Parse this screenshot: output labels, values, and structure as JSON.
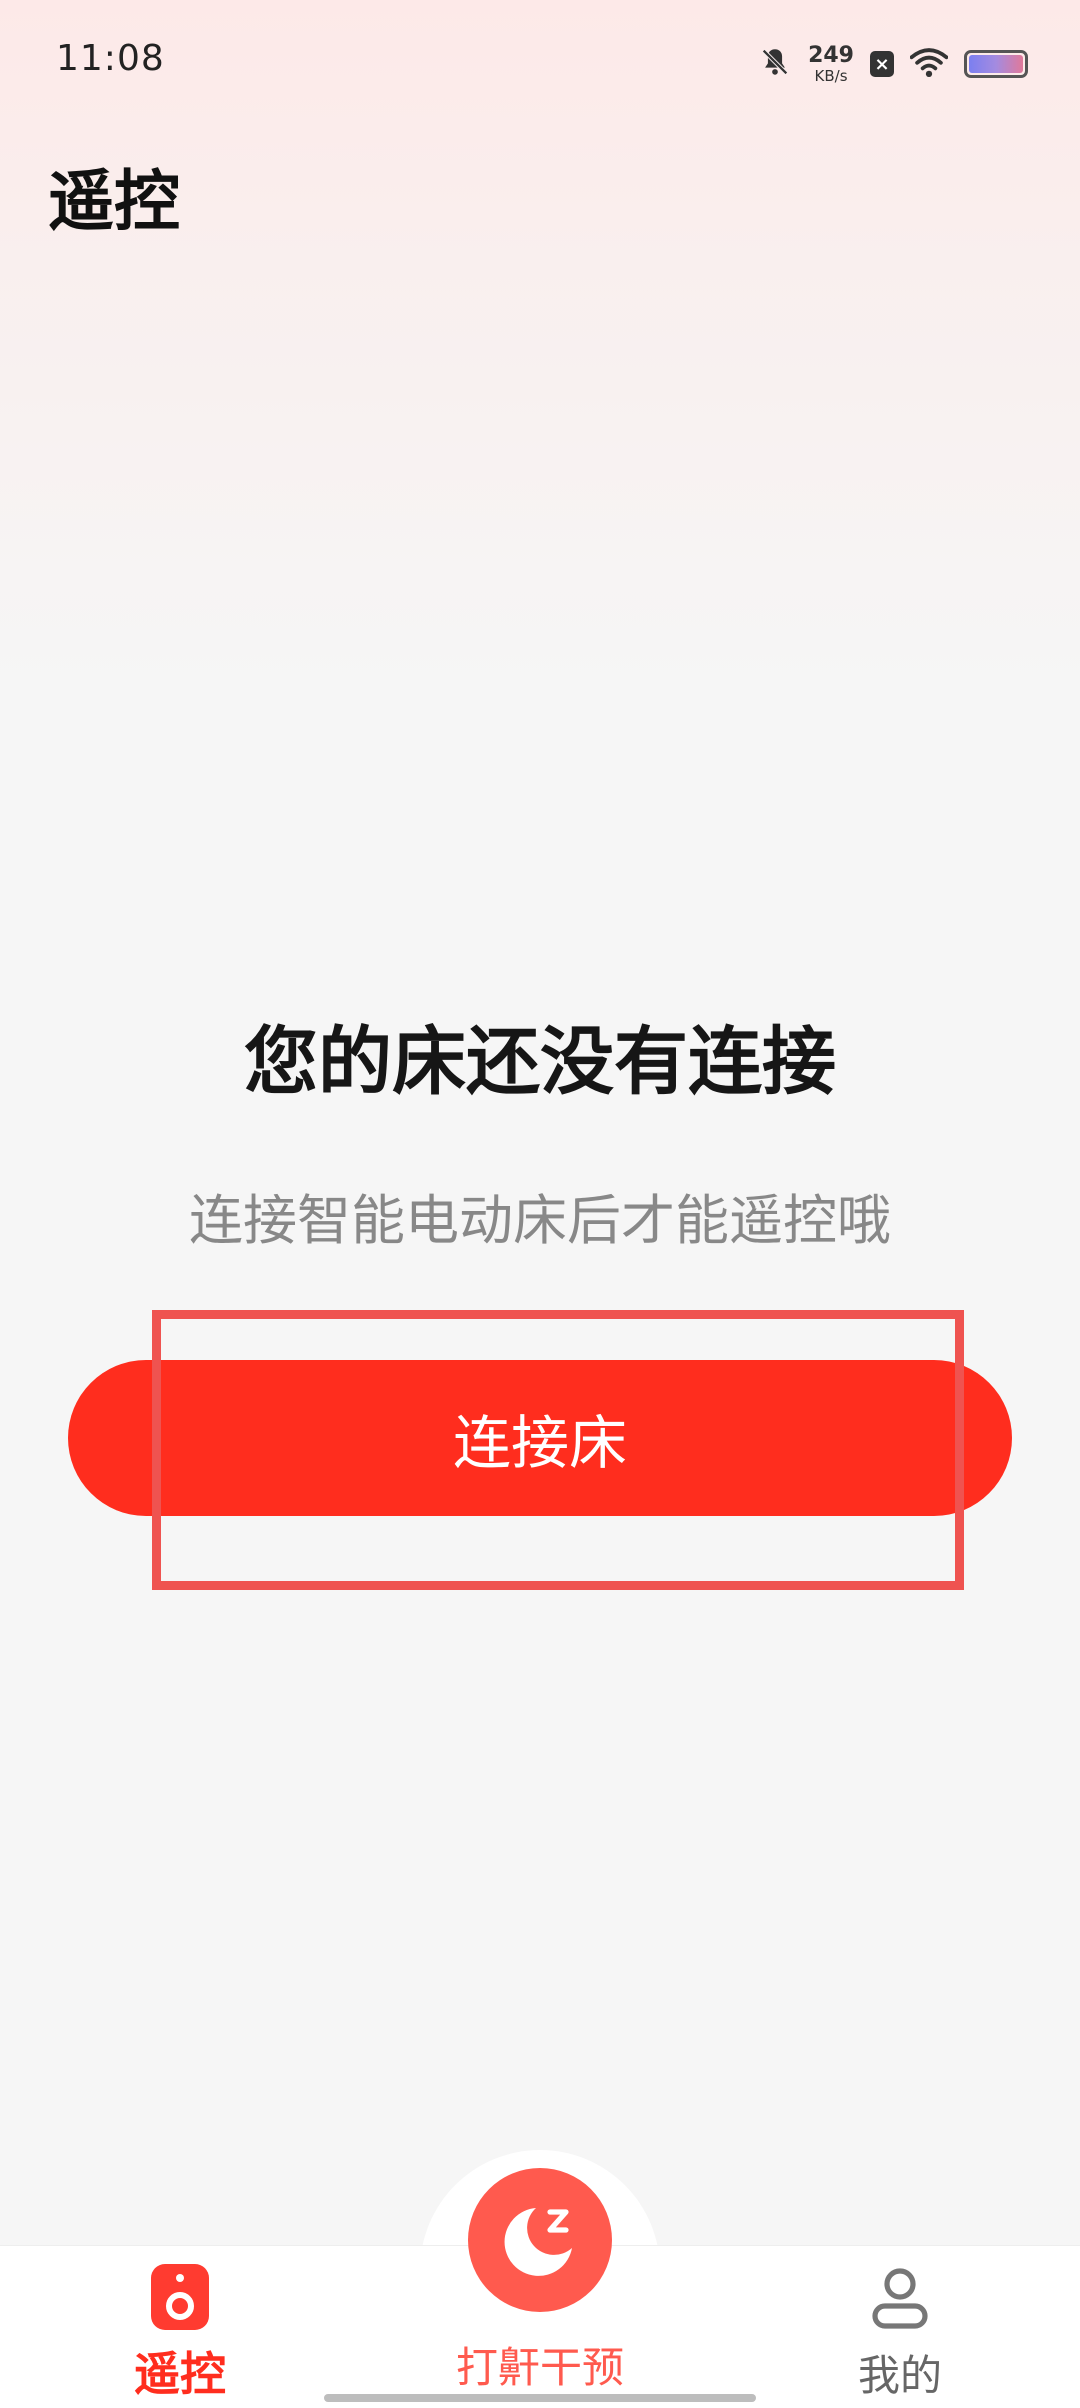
{
  "status_bar": {
    "time": "11:08",
    "net_speed_value": "249",
    "net_speed_unit": "KB/s",
    "sim_badge": "×",
    "icons": [
      "bell-off-icon",
      "wifi-icon",
      "battery-icon"
    ]
  },
  "header": {
    "title": "遥控"
  },
  "empty_state": {
    "title": "您的床还没有连接",
    "subtitle": "连接智能电动床后才能遥控哦",
    "button_label": "连接床"
  },
  "bottom_nav": {
    "items": [
      {
        "label": "遥控",
        "icon": "remote-icon",
        "active": true
      },
      {
        "label": "打鼾干预",
        "icon": "moon-z-icon",
        "active": false
      },
      {
        "label": "我的",
        "icon": "user-icon",
        "active": false
      }
    ]
  },
  "colors": {
    "accent": "#ff2d1e",
    "snore_accent": "#ff5a4e",
    "highlight_box": "#ef5350"
  }
}
